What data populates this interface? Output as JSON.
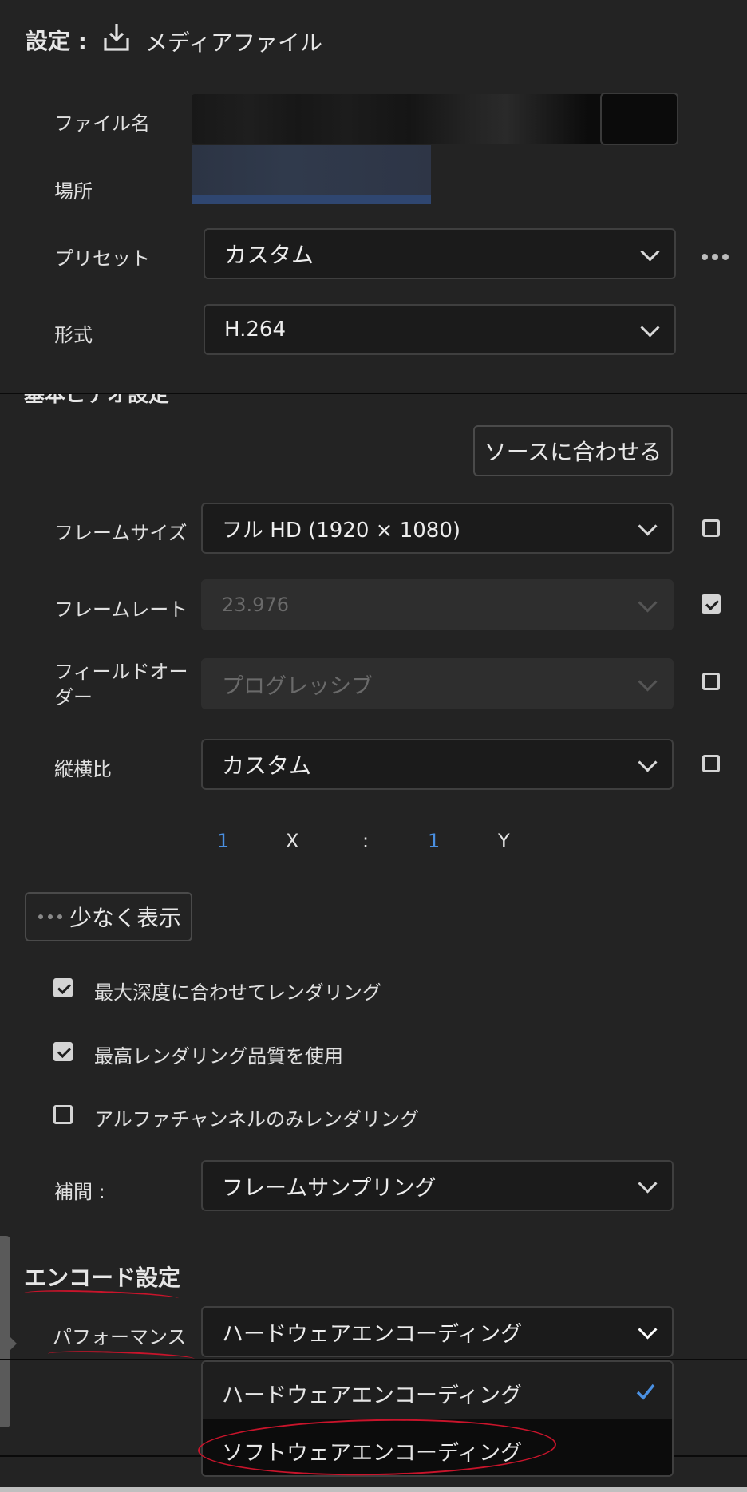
{
  "header": {
    "settings_label": "設定 :",
    "media_file_label": "メディアファイル"
  },
  "output": {
    "filename_label": "ファイル名",
    "location_label": "場所",
    "preset_label": "プリセット",
    "preset_value": "カスタム",
    "format_label": "形式",
    "format_value": "H.264"
  },
  "video": {
    "section_title_partial": "基本ビデオ設定",
    "match_source_button": "ソースに合わせる",
    "frame_size_label": "フレームサイズ",
    "frame_size_value": "フル HD (1920 × 1080)",
    "frame_rate_label": "フレームレート",
    "frame_rate_value": "23.976",
    "field_order_label": "フィールドオーダー",
    "field_order_value": "プログレッシブ",
    "aspect_label": "縦横比",
    "aspect_value": "カスタム",
    "aspect_x_value": "1",
    "aspect_x_label": "X",
    "aspect_colon": ":",
    "aspect_y_value": "1",
    "aspect_y_label": "Y",
    "show_less_button": "少なく表示",
    "render_max_depth": "最大深度に合わせてレンダリング",
    "max_render_quality": "最高レンダリング品質を使用",
    "render_alpha_only": "アルファチャンネルのみレンダリング",
    "interpolation_label": "補間 :",
    "interpolation_value": "フレームサンプリング"
  },
  "encoding": {
    "section_title": "エンコード設定",
    "performance_label": "パフォーマンス",
    "performance_value": "ハードウェアエンコーディング",
    "options": [
      "ハードウェアエンコーディング",
      "ソフトウェアエンコーディング"
    ]
  },
  "colors": {
    "accent": "#4a90e2",
    "annotation_red": "#c9142b",
    "background": "#232323"
  }
}
